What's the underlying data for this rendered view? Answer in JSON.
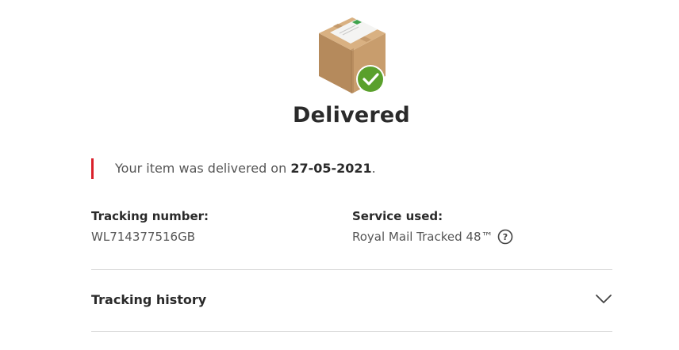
{
  "status": {
    "title": "Delivered",
    "icon": "parcel-delivered-icon",
    "check_color": "#5aa02c"
  },
  "notice": {
    "prefix": "Your item was delivered on ",
    "date": "27-05-2021",
    "suffix": ".",
    "accent_color": "#da202a"
  },
  "tracking": {
    "label": "Tracking number:",
    "value": "WL714377516GB"
  },
  "service": {
    "label": "Service used:",
    "value": "Royal Mail Tracked 48™",
    "help_icon": "help-circle-icon"
  },
  "history": {
    "label": "Tracking history",
    "icon": "chevron-down-icon"
  }
}
